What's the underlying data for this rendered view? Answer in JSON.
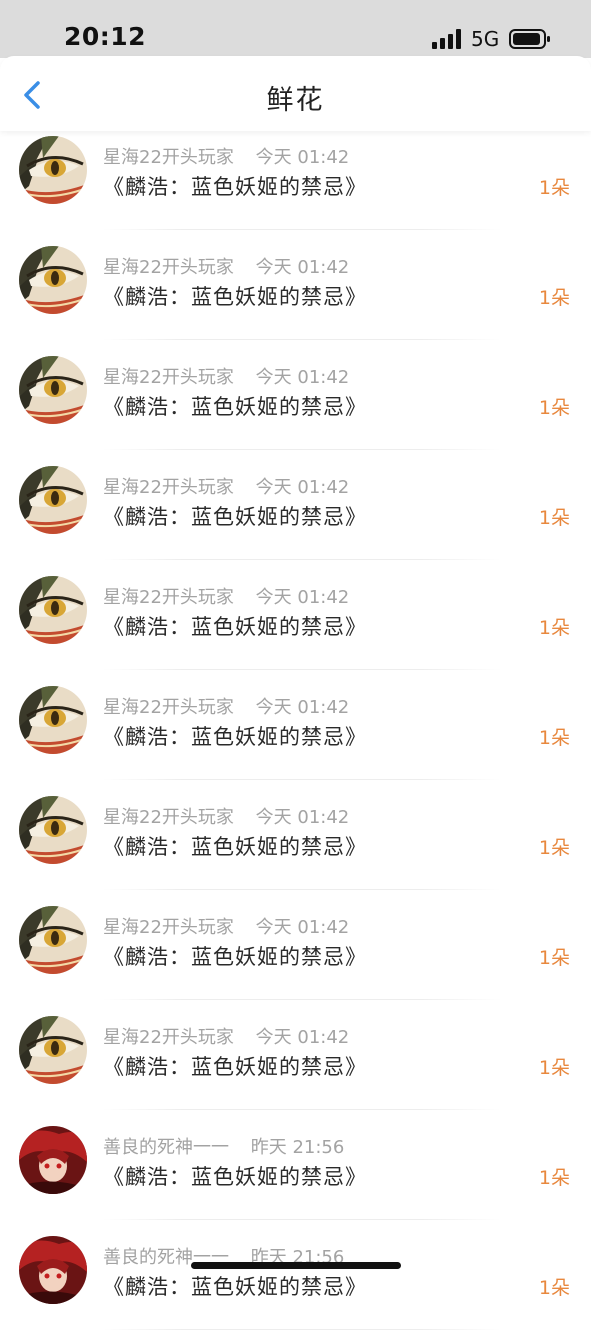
{
  "status_bar": {
    "time": "20:12",
    "network": "5G"
  },
  "header": {
    "title": "鲜花",
    "back_icon": "chevron-left-icon"
  },
  "colors": {
    "accent_back": "#3a8ee6",
    "flower_count": "#e8883e",
    "meta_text": "#a3a3a3"
  },
  "items": [
    {
      "avatar": "anime-eye-avatar",
      "user": "星海22开头玩家",
      "time": "今天 01:42",
      "title": "《麟浩：蓝色妖姬的禁忌》",
      "count": "1朵"
    },
    {
      "avatar": "anime-eye-avatar",
      "user": "星海22开头玩家",
      "time": "今天 01:42",
      "title": "《麟浩：蓝色妖姬的禁忌》",
      "count": "1朵"
    },
    {
      "avatar": "anime-eye-avatar",
      "user": "星海22开头玩家",
      "time": "今天 01:42",
      "title": "《麟浩：蓝色妖姬的禁忌》",
      "count": "1朵"
    },
    {
      "avatar": "anime-eye-avatar",
      "user": "星海22开头玩家",
      "time": "今天 01:42",
      "title": "《麟浩：蓝色妖姬的禁忌》",
      "count": "1朵"
    },
    {
      "avatar": "anime-eye-avatar",
      "user": "星海22开头玩家",
      "time": "今天 01:42",
      "title": "《麟浩：蓝色妖姬的禁忌》",
      "count": "1朵"
    },
    {
      "avatar": "anime-eye-avatar",
      "user": "星海22开头玩家",
      "time": "今天 01:42",
      "title": "《麟浩：蓝色妖姬的禁忌》",
      "count": "1朵"
    },
    {
      "avatar": "anime-eye-avatar",
      "user": "星海22开头玩家",
      "time": "今天 01:42",
      "title": "《麟浩：蓝色妖姬的禁忌》",
      "count": "1朵"
    },
    {
      "avatar": "anime-eye-avatar",
      "user": "星海22开头玩家",
      "time": "今天 01:42",
      "title": "《麟浩：蓝色妖姬的禁忌》",
      "count": "1朵"
    },
    {
      "avatar": "anime-eye-avatar",
      "user": "星海22开头玩家",
      "time": "今天 01:42",
      "title": "《麟浩：蓝色妖姬的禁忌》",
      "count": "1朵"
    },
    {
      "avatar": "red-hair-avatar",
      "user": "善良的死神一一",
      "time": "昨天 21:56",
      "title": "《麟浩：蓝色妖姬的禁忌》",
      "count": "1朵"
    },
    {
      "avatar": "red-hair-avatar",
      "user": "善良的死神一一",
      "time": "昨天 21:56",
      "title": "《麟浩：蓝色妖姬的禁忌》",
      "count": "1朵"
    }
  ]
}
